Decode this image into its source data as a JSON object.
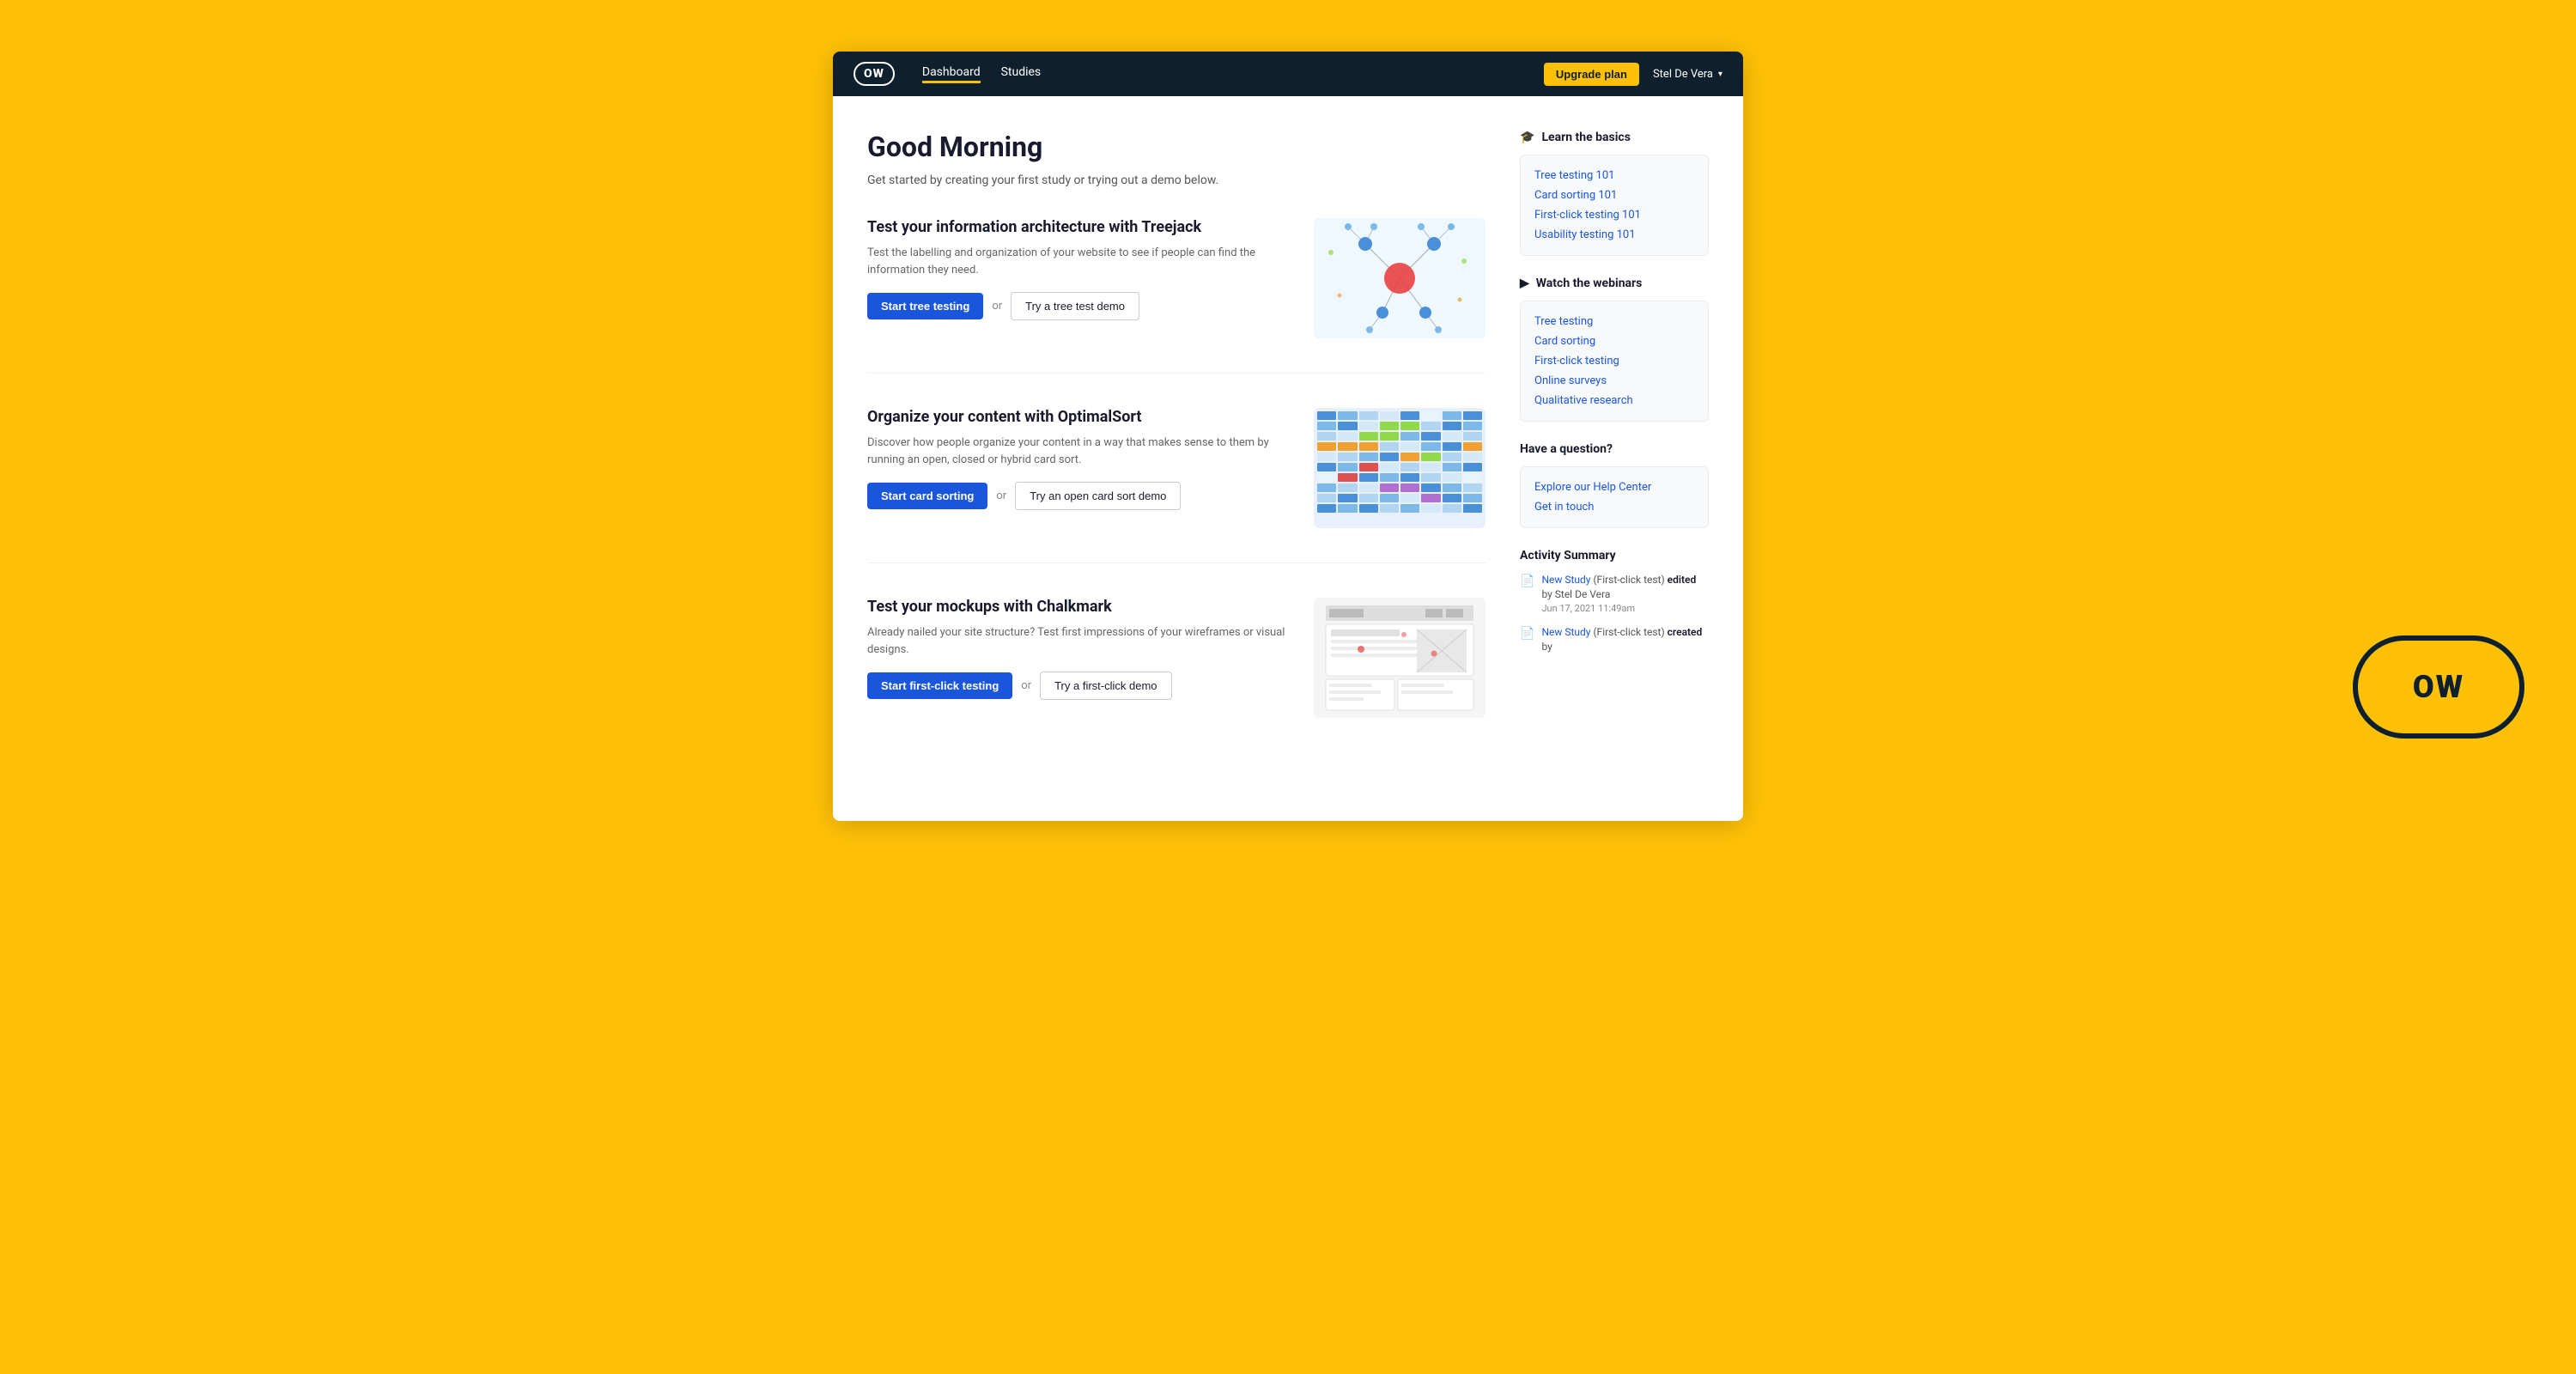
{
  "navbar": {
    "logo": "OW",
    "links": [
      {
        "label": "Dashboard",
        "active": true
      },
      {
        "label": "Studies",
        "active": false
      }
    ],
    "upgrade_label": "Upgrade plan",
    "user_name": "Stel De Vera"
  },
  "page": {
    "greeting": "Good Morning",
    "subtitle": "Get started by creating your first study or trying out a demo below."
  },
  "studies": [
    {
      "title": "Test your information architecture with Treejack",
      "description": "Test the labelling and organization of your website to see if people can find the information they need.",
      "primary_btn": "Start tree testing",
      "secondary_btn": "Try a tree test demo",
      "image_type": "tree"
    },
    {
      "title": "Organize your content with OptimalSort",
      "description": "Discover how people organize your content in a way that makes sense to them by running an open, closed or hybrid card sort.",
      "primary_btn": "Start card sorting",
      "secondary_btn": "Try an open card sort demo",
      "image_type": "card_sort"
    },
    {
      "title": "Test your mockups with Chalkmark",
      "description": "Already nailed your site structure? Test first impressions of your wireframes or visual designs.",
      "primary_btn": "Start first-click testing",
      "secondary_btn": "Try a first-click demo",
      "image_type": "chalkmark"
    }
  ],
  "sidebar": {
    "learn_title": "Learn the basics",
    "learn_links": [
      {
        "label": "Tree testing 101"
      },
      {
        "label": "Card sorting 101"
      },
      {
        "label": "First-click testing 101"
      },
      {
        "label": "Usability testing 101"
      }
    ],
    "webinars_title": "Watch the webinars",
    "webinar_links": [
      {
        "label": "Tree testing"
      },
      {
        "label": "Card sorting"
      },
      {
        "label": "First-click testing"
      },
      {
        "label": "Online surveys"
      },
      {
        "label": "Qualitative research"
      }
    ],
    "question_title": "Have a question?",
    "question_links": [
      {
        "label": "Explore our Help Center"
      },
      {
        "label": "Get in touch"
      }
    ],
    "activity_title": "Activity Summary",
    "activity_items": [
      {
        "type": "edit",
        "link_text": "New Study",
        "study_type": "(First-click test)",
        "action": "edited",
        "by": "by Stel De Vera",
        "time": "Jun 17, 2021 11:49am"
      },
      {
        "type": "create",
        "link_text": "New Study",
        "study_type": "(First-click test)",
        "action": "created",
        "by": "by",
        "time": ""
      }
    ]
  },
  "or_text": "or"
}
